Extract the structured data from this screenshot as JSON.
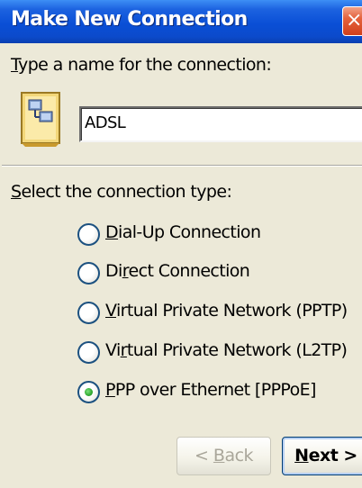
{
  "window": {
    "title": "Make New Connection",
    "close_glyph": "×"
  },
  "name_section": {
    "prompt_first": "T",
    "prompt_rest": "ype a name for the connection:",
    "icon": "network-connection-icon",
    "name_value": "ADSL"
  },
  "type_section": {
    "prompt_first": "S",
    "prompt_rest": "elect the connection type:",
    "options": [
      {
        "pre": "",
        "key": "D",
        "post": "ial-Up Connection",
        "selected": false
      },
      {
        "pre": "Di",
        "key": "r",
        "post": "ect Connection",
        "selected": false
      },
      {
        "pre": "",
        "key": "V",
        "post": "irtual Private Network (PPTP)",
        "selected": false
      },
      {
        "pre": "Vi",
        "key": "r",
        "post": "tual Private Network (L2TP)",
        "selected": false
      },
      {
        "pre": "",
        "key": "P",
        "post": "PP over Ethernet [PPPoE]",
        "selected": true
      }
    ]
  },
  "buttons": {
    "back_pre": "< ",
    "back_key": "B",
    "back_post": "ack",
    "back_enabled": false,
    "next_key": "N",
    "next_post": "ext >"
  },
  "colors": {
    "title_bar": "#0A4FD6",
    "dialog_bg": "#ECE9D8",
    "close_button": "#D2401C",
    "radio_selected": "#2FA82F"
  }
}
